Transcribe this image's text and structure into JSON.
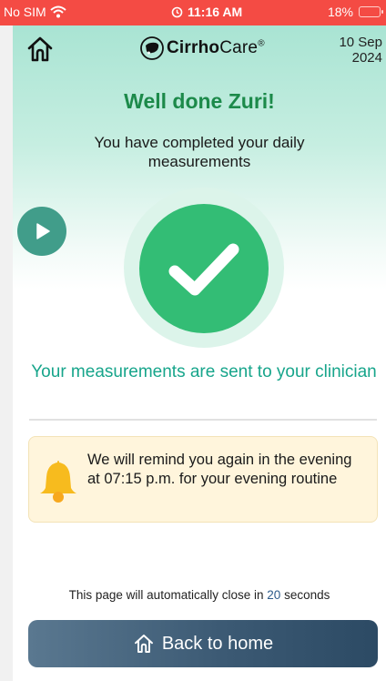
{
  "status_bar": {
    "carrier": "No SIM",
    "time": "11:16 AM",
    "battery": "18%",
    "background_color": "#f44b44"
  },
  "header": {
    "home_icon": "home-icon",
    "logo_bold": "Cirrho",
    "logo_regular": "Care",
    "logo_mark": "®",
    "date_line1": "10 Sep",
    "date_line2": "2024"
  },
  "main": {
    "title": "Well done Zuri!",
    "subtitle": "You have completed your daily measurements",
    "play_icon": "play-icon",
    "check_icon": "checkmark-icon",
    "sent_message": "Your measurements are sent to your clinician"
  },
  "reminder": {
    "icon": "bell-icon",
    "text": "We will remind you again in the evening at 07:15 p.m. for your evening routine"
  },
  "footer": {
    "auto_close_prefix": "This page will automatically close in",
    "countdown": "20",
    "auto_close_suffix": "seconds",
    "back_button_label": "Back to home"
  },
  "colors": {
    "title_green": "#1c8a4a",
    "check_green": "#33bd75",
    "teal_text": "#17a58b",
    "play_teal": "#419d8a",
    "reminder_bg": "#fff5dc",
    "bell_yellow": "#f7bb1e",
    "button_dark": "#3c5a74"
  }
}
